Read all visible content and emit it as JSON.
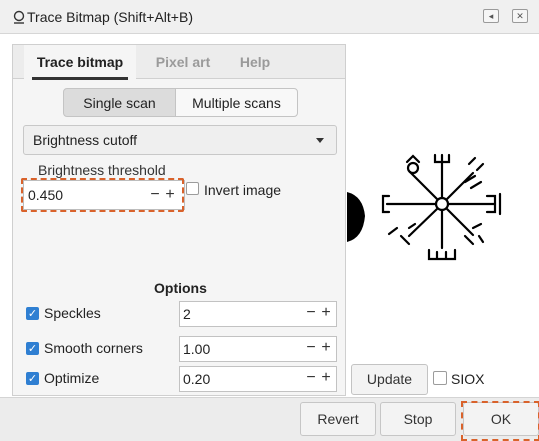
{
  "window": {
    "title": "Trace Bitmap (Shift+Alt+B)",
    "icon": "trace-bitmap-icon",
    "buttons": [
      "restore-icon",
      "close-icon"
    ]
  },
  "tabs": [
    {
      "label": "Trace bitmap",
      "active": true
    },
    {
      "label": "Pixel art",
      "active": false
    },
    {
      "label": "Help",
      "active": false
    }
  ],
  "scan_mode": {
    "single": "Single scan",
    "multiple": "Multiple scans",
    "selected": "Single scan"
  },
  "detection": {
    "selected": "Brightness cutoff"
  },
  "threshold": {
    "label": "Brightness threshold",
    "value": "0.450",
    "minus": "−",
    "plus": "+"
  },
  "invert": {
    "label": "Invert image",
    "checked": false
  },
  "options": {
    "title": "Options",
    "items": [
      {
        "label": "Speckles",
        "value": "2",
        "checked": true
      },
      {
        "label": "Smooth corners",
        "value": "1.00",
        "checked": true
      },
      {
        "label": "Optimize",
        "value": "0.20",
        "checked": true
      }
    ],
    "minus": "−",
    "plus": "+"
  },
  "preview": {
    "update_label": "Update",
    "siox_label": "SIOX",
    "siox_checked": false
  },
  "footer": {
    "revert_label": "Revert",
    "stop_label": "Stop",
    "ok_label": "OK"
  },
  "colors": {
    "accent": "#2f7fd2",
    "highlight": "#d9622b"
  }
}
